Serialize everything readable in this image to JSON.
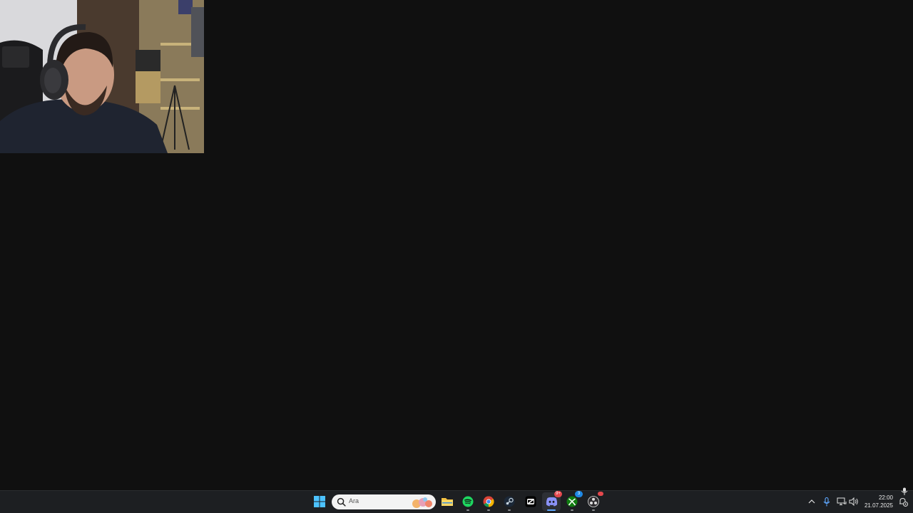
{
  "taskbar": {
    "search": {
      "placeholder": "Ara"
    },
    "apps": [
      {
        "name": "start",
        "icon": "windows-logo-icon"
      },
      {
        "name": "file-explorer",
        "icon": "folder-icon"
      },
      {
        "name": "spotify",
        "icon": "spotify-icon"
      },
      {
        "name": "chrome",
        "icon": "chrome-icon"
      },
      {
        "name": "steam",
        "icon": "steam-icon"
      },
      {
        "name": "capcut",
        "icon": "capcut-icon"
      },
      {
        "name": "discord",
        "icon": "discord-icon",
        "badge": "9+"
      },
      {
        "name": "xbox",
        "icon": "xbox-icon",
        "badge": "3"
      },
      {
        "name": "obs",
        "icon": "obs-icon"
      }
    ]
  },
  "tray": {
    "clock_time": "22:00",
    "clock_date": "21.07.2025"
  },
  "colors": {
    "desktop_bg": "#101010",
    "taskbar_bg": "#1d1f22",
    "accent": "#5fa8ff",
    "discord_badge": "#e5484d",
    "xbox_badge": "#1e88e5"
  }
}
